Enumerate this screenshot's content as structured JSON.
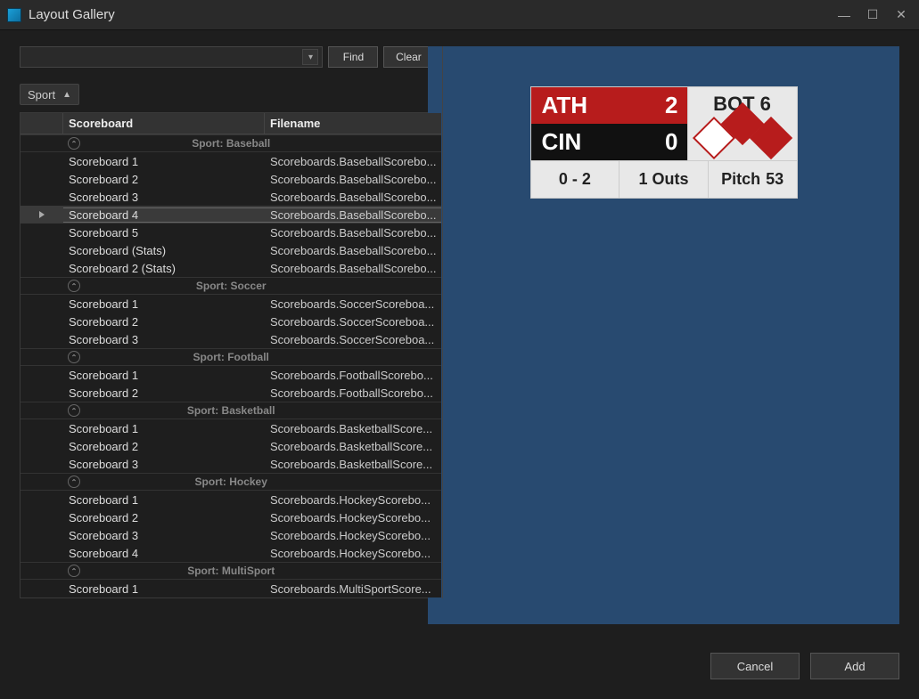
{
  "window": {
    "title": "Layout Gallery"
  },
  "toolbar": {
    "search_value": "",
    "find_label": "Find",
    "clear_label": "Clear"
  },
  "group_by": {
    "label": "Sport"
  },
  "columns": {
    "scoreboard": "Scoreboard",
    "filename": "Filename"
  },
  "groups": [
    {
      "label": "Sport: Baseball",
      "rows": [
        {
          "sb": "Scoreboard 1",
          "fn": "Scoreboards.BaseballScorebo..."
        },
        {
          "sb": "Scoreboard 2",
          "fn": "Scoreboards.BaseballScorebo..."
        },
        {
          "sb": "Scoreboard 3",
          "fn": "Scoreboards.BaseballScorebo..."
        },
        {
          "sb": "Scoreboard 4",
          "fn": "Scoreboards.BaseballScorebo...",
          "selected": true
        },
        {
          "sb": "Scoreboard 5",
          "fn": "Scoreboards.BaseballScorebo..."
        },
        {
          "sb": "Scoreboard (Stats)",
          "fn": "Scoreboards.BaseballScorebo..."
        },
        {
          "sb": "Scoreboard 2 (Stats)",
          "fn": "Scoreboards.BaseballScorebo..."
        }
      ]
    },
    {
      "label": "Sport: Soccer",
      "rows": [
        {
          "sb": "Scoreboard 1",
          "fn": "Scoreboards.SoccerScoreboa..."
        },
        {
          "sb": "Scoreboard 2",
          "fn": "Scoreboards.SoccerScoreboa..."
        },
        {
          "sb": "Scoreboard 3",
          "fn": "Scoreboards.SoccerScoreboa..."
        }
      ]
    },
    {
      "label": "Sport: Football",
      "rows": [
        {
          "sb": "Scoreboard 1",
          "fn": "Scoreboards.FootballScorebo..."
        },
        {
          "sb": "Scoreboard 2",
          "fn": "Scoreboards.FootballScorebo..."
        }
      ]
    },
    {
      "label": "Sport: Basketball",
      "rows": [
        {
          "sb": "Scoreboard 1",
          "fn": "Scoreboards.BasketballScore..."
        },
        {
          "sb": "Scoreboard 2",
          "fn": "Scoreboards.BasketballScore..."
        },
        {
          "sb": "Scoreboard 3",
          "fn": "Scoreboards.BasketballScore..."
        }
      ]
    },
    {
      "label": "Sport: Hockey",
      "rows": [
        {
          "sb": "Scoreboard 1",
          "fn": "Scoreboards.HockeyScorebo..."
        },
        {
          "sb": "Scoreboard 2",
          "fn": "Scoreboards.HockeyScorebo..."
        },
        {
          "sb": "Scoreboard 3",
          "fn": "Scoreboards.HockeyScorebo..."
        },
        {
          "sb": "Scoreboard 4",
          "fn": "Scoreboards.HockeyScorebo..."
        }
      ]
    },
    {
      "label": "Sport: MultiSport",
      "rows": [
        {
          "sb": "Scoreboard 1",
          "fn": "Scoreboards.MultiSportScore..."
        }
      ]
    }
  ],
  "preview": {
    "away_abbr": "ATH",
    "away_score": "2",
    "home_abbr": "CIN",
    "home_score": "0",
    "inning": "BOT 6",
    "count": "0 - 2",
    "outs": "1 Outs",
    "pitch_label": "Pitch",
    "pitch_count": "53"
  },
  "buttons": {
    "cancel": "Cancel",
    "add": "Add"
  }
}
